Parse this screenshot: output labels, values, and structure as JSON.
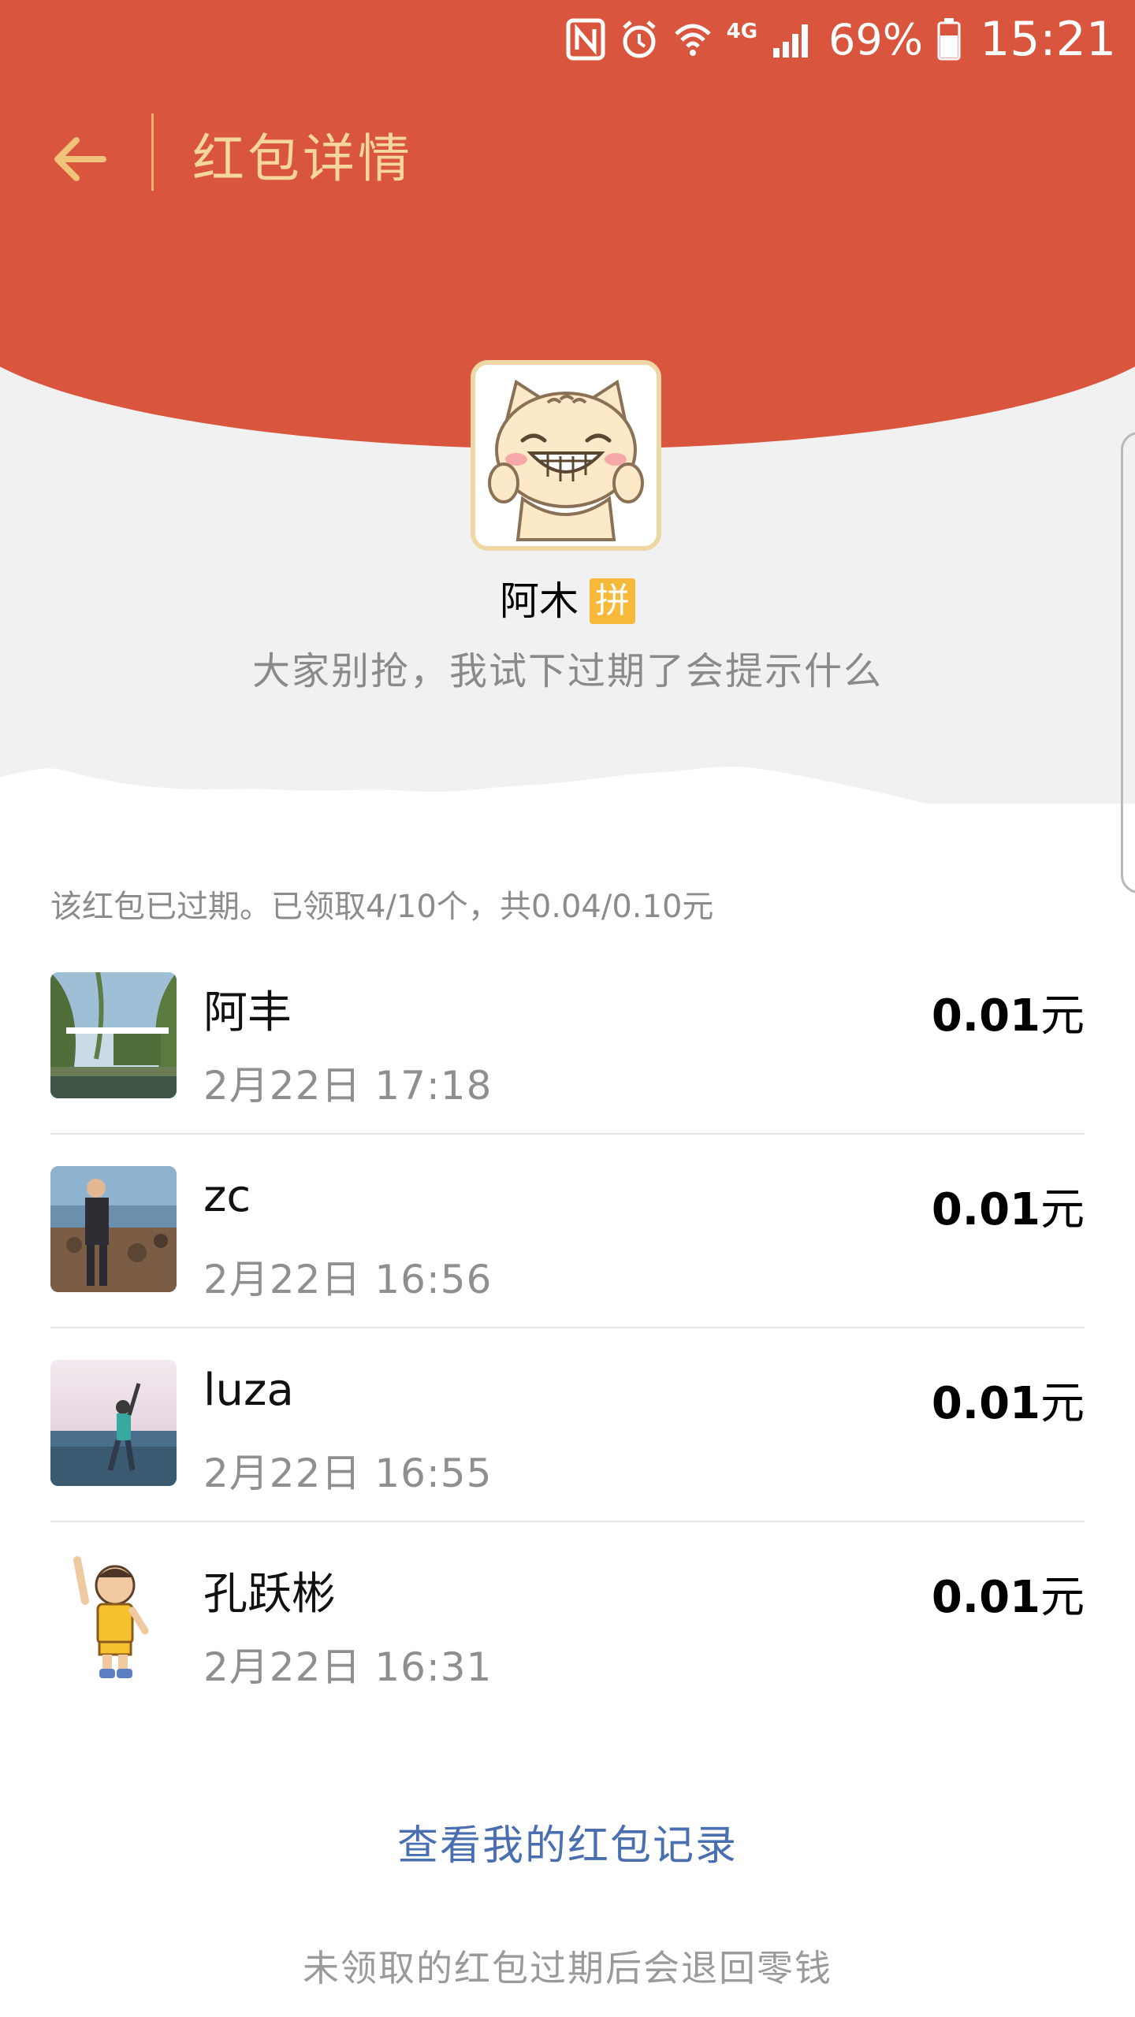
{
  "status_bar": {
    "icons": [
      "nfc-icon",
      "alarm-icon",
      "wifi-icon",
      "4g-icon",
      "signal-icon",
      "battery-icon"
    ],
    "network_label": "4G",
    "battery_text": "69%",
    "time": "15:21"
  },
  "header": {
    "title": "红包详情",
    "back_icon": "back-arrow-icon"
  },
  "sender": {
    "name": "阿木",
    "badge": "拼",
    "message": "大家别抢，我试下过期了会提示什么"
  },
  "summary": "该红包已过期。已领取4/10个，共0.04/0.10元",
  "receivers": [
    {
      "name": "阿丰",
      "time": "2月22日  17:18",
      "amount": "0.01",
      "unit": "元"
    },
    {
      "name": "zc",
      "time": "2月22日  16:56",
      "amount": "0.01",
      "unit": "元"
    },
    {
      "name": "luza",
      "time": "2月22日  16:55",
      "amount": "0.01",
      "unit": "元"
    },
    {
      "name": "孔跃彬",
      "time": "2月22日  16:31",
      "amount": "0.01",
      "unit": "元"
    }
  ],
  "record_link": "查看我的红包记录",
  "footer_note": "未领取的红包过期后会退回零钱",
  "colors": {
    "header_red": "#d9553e",
    "title_gold": "#f6d69a",
    "badge_yellow": "#f6b93a",
    "link_blue": "#4a6fb0"
  }
}
